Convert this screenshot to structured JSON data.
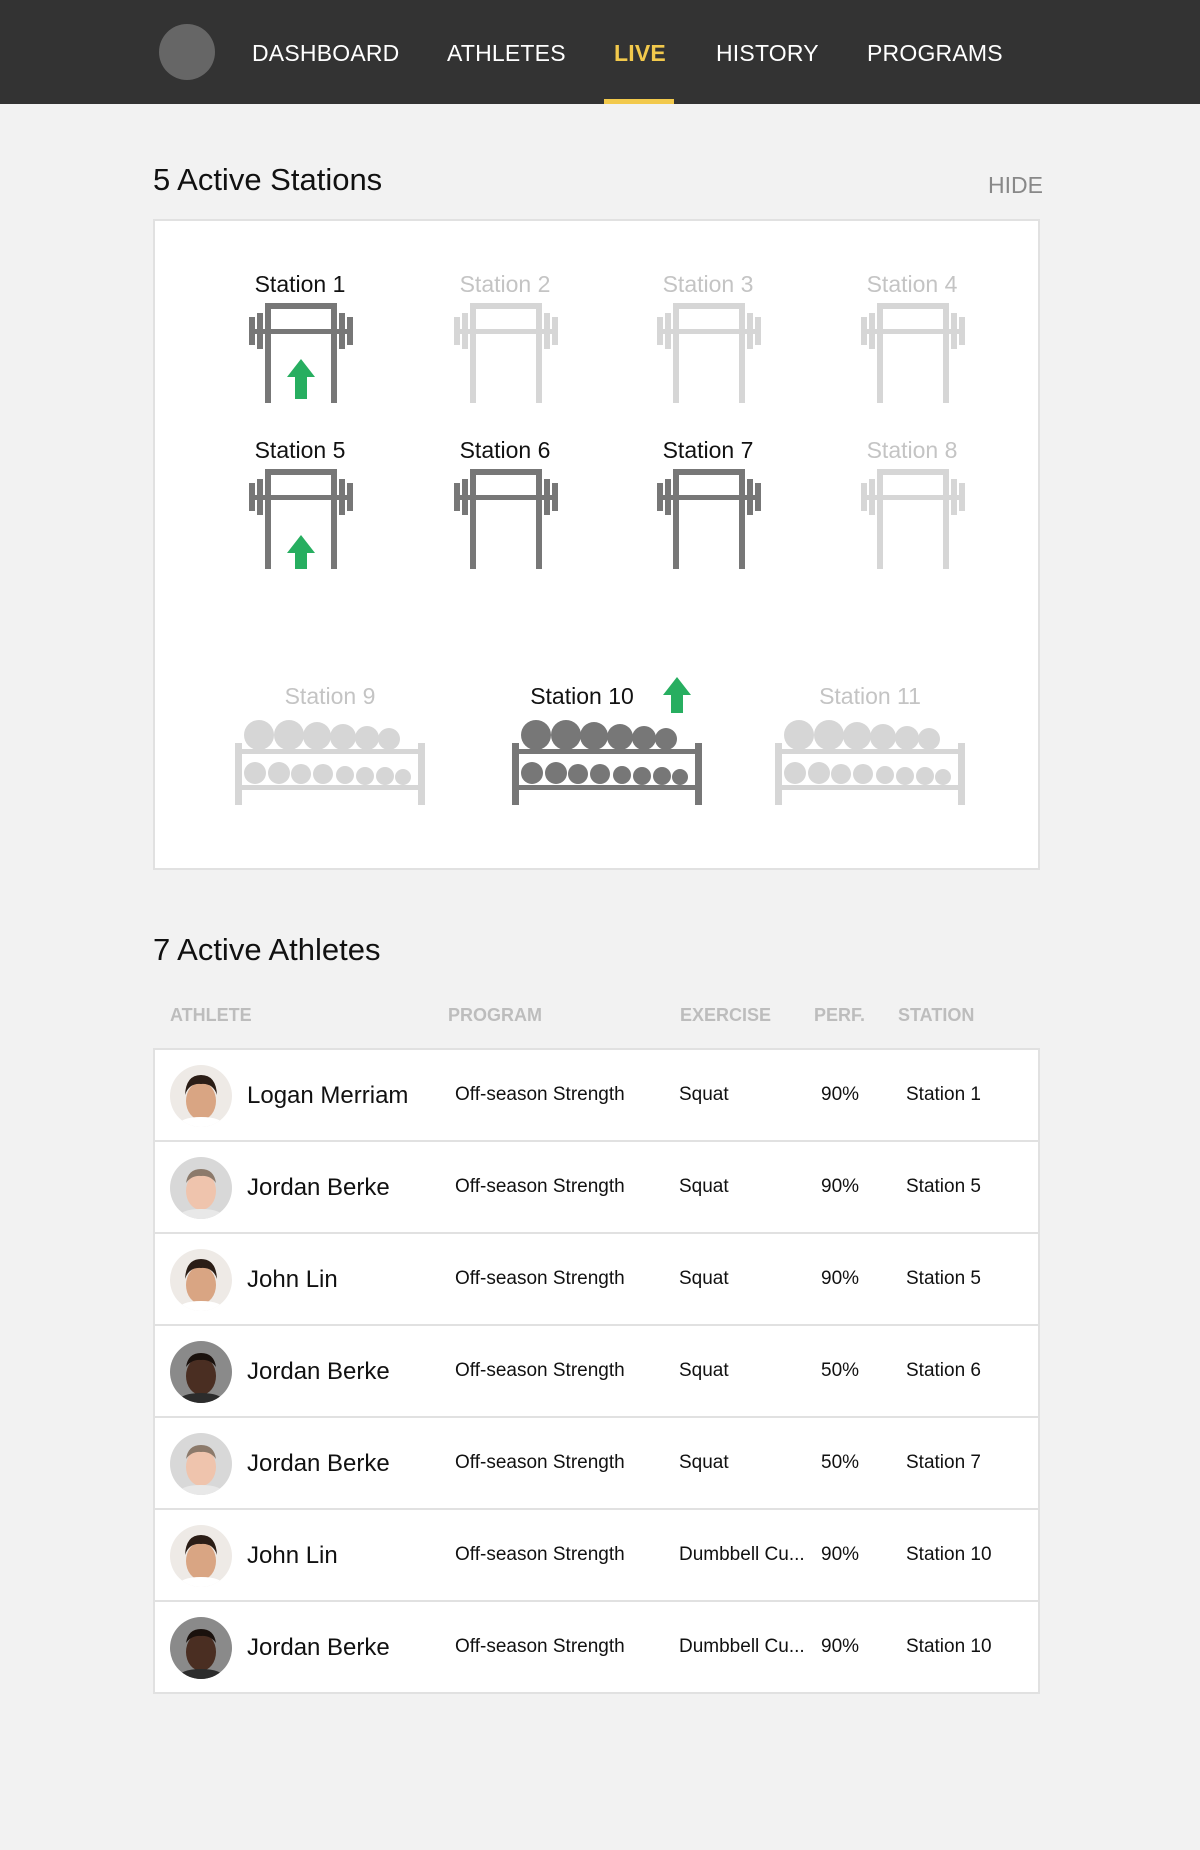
{
  "nav": {
    "items": [
      {
        "label": "DASHBOARD"
      },
      {
        "label": "ATHLETES"
      },
      {
        "label": "LIVE"
      },
      {
        "label": "HISTORY"
      },
      {
        "label": "PROGRAMS"
      }
    ],
    "active": "LIVE",
    "accent_color": "#f2c94c"
  },
  "stations_section": {
    "title": "5 Active Stations",
    "hide_label": "HIDE",
    "stations": [
      {
        "label": "Station 1",
        "type": "squat-rack",
        "active": true,
        "trend": "up"
      },
      {
        "label": "Station 2",
        "type": "squat-rack",
        "active": false
      },
      {
        "label": "Station 3",
        "type": "squat-rack",
        "active": false
      },
      {
        "label": "Station 4",
        "type": "squat-rack",
        "active": false
      },
      {
        "label": "Station 5",
        "type": "squat-rack",
        "active": true,
        "trend": "up"
      },
      {
        "label": "Station 6",
        "type": "squat-rack",
        "active": true
      },
      {
        "label": "Station 7",
        "type": "squat-rack",
        "active": true
      },
      {
        "label": "Station 8",
        "type": "squat-rack",
        "active": false
      },
      {
        "label": "Station 9",
        "type": "dumbbell-rack",
        "active": false
      },
      {
        "label": "Station 10",
        "type": "dumbbell-rack",
        "active": true,
        "trend": "up"
      },
      {
        "label": "Station 11",
        "type": "dumbbell-rack",
        "active": false
      }
    ],
    "trend_color": "#27ae60"
  },
  "athletes_section": {
    "title": "7 Active Athletes",
    "columns": [
      "ATHLETE",
      "PROGRAM",
      "EXERCISE",
      "PERF.",
      "STATION"
    ],
    "rows": [
      {
        "name": "Logan Merriam",
        "program": "Off-season Strength",
        "exercise": "Squat",
        "perf": "90%",
        "station": "Station 1",
        "avatar": "avatar-light-dark-hair"
      },
      {
        "name": "Jordan Berke",
        "program": "Off-season Strength",
        "exercise": "Squat",
        "perf": "90%",
        "station": "Station 5",
        "avatar": "avatar-light-short-hair"
      },
      {
        "name": "John Lin",
        "program": "Off-season Strength",
        "exercise": "Squat",
        "perf": "90%",
        "station": "Station 5",
        "avatar": "avatar-light-dark-hair"
      },
      {
        "name": "Jordan Berke",
        "program": "Off-season Strength",
        "exercise": "Squat",
        "perf": "50%",
        "station": "Station 6",
        "avatar": "avatar-dark-skin"
      },
      {
        "name": "Jordan Berke",
        "program": "Off-season Strength",
        "exercise": "Squat",
        "perf": "50%",
        "station": "Station 7",
        "avatar": "avatar-light-short-hair"
      },
      {
        "name": "John Lin",
        "program": "Off-season Strength",
        "exercise": "Dumbbell Cu...",
        "perf": "90%",
        "station": "Station 10",
        "avatar": "avatar-light-dark-hair"
      },
      {
        "name": "Jordan Berke",
        "program": "Off-season Strength",
        "exercise": "Dumbbell Cu...",
        "perf": "90%",
        "station": "Station 10",
        "avatar": "avatar-dark-skin"
      }
    ]
  }
}
